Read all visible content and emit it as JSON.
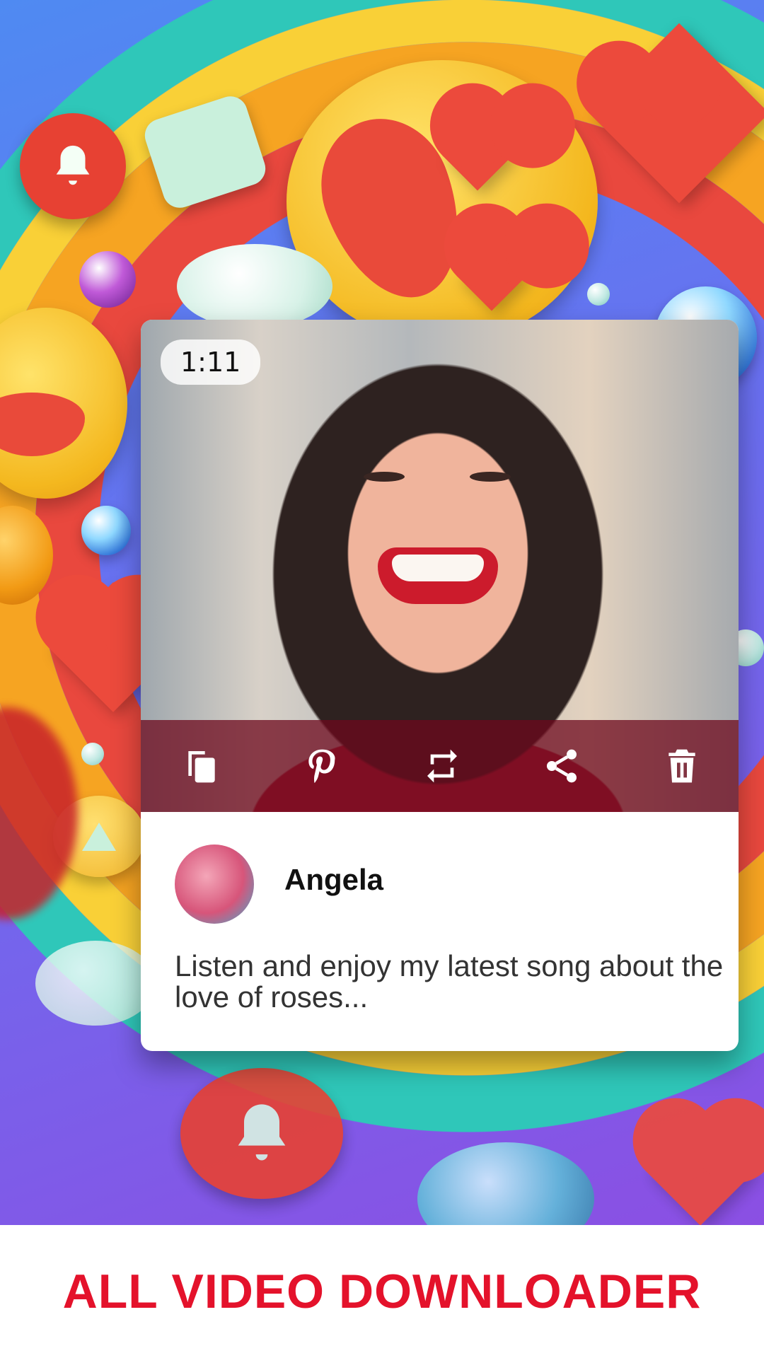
{
  "post": {
    "duration": "1:11",
    "author": "Angela",
    "caption": "Listen and enjoy my latest song about the love of roses..."
  },
  "actions": [
    {
      "name": "copy-icon"
    },
    {
      "name": "pinterest-icon"
    },
    {
      "name": "repost-icon"
    },
    {
      "name": "share-icon"
    },
    {
      "name": "delete-icon"
    }
  ],
  "footer": {
    "title": "ALL VIDEO DOWNLOADER"
  },
  "colors": {
    "brand_red": "#e4122b",
    "action_bar": "#6e081c"
  }
}
